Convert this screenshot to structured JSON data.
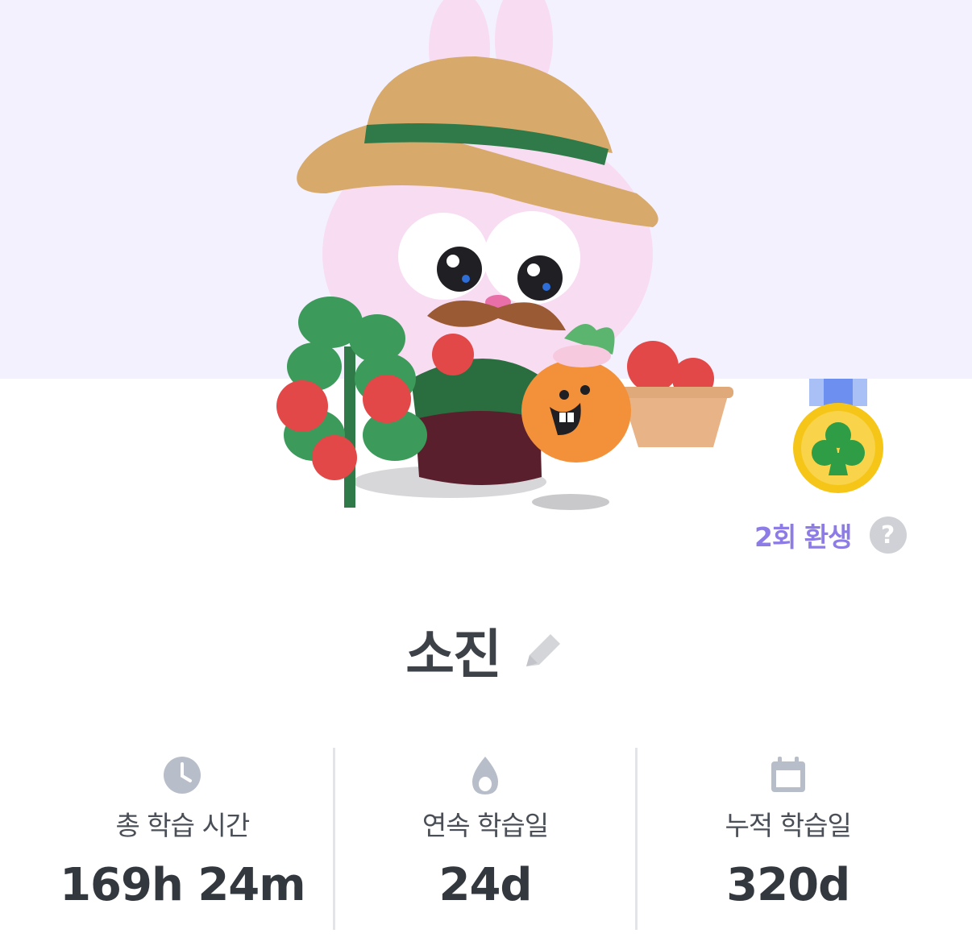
{
  "profile": {
    "name": "소진",
    "rebirth_label": "2회 환생",
    "help_glyph": "?",
    "medal_icon": "club-medal-icon",
    "edit_icon": "pencil-icon"
  },
  "stats": [
    {
      "icon": "clock-icon",
      "label": "총 학습 시간",
      "value": "169h 24m"
    },
    {
      "icon": "flame-icon",
      "label": "연속 학습일",
      "value": "24d"
    },
    {
      "icon": "calendar-icon",
      "label": "누적 학습일",
      "value": "320d"
    }
  ],
  "colors": {
    "hero_background": "#f3f1fe",
    "accent_purple": "#8d7ce6",
    "icon_gray": "#b8bec9",
    "medal_gold": "#f5c518",
    "ribbon_blue": "#6c8ff0"
  }
}
